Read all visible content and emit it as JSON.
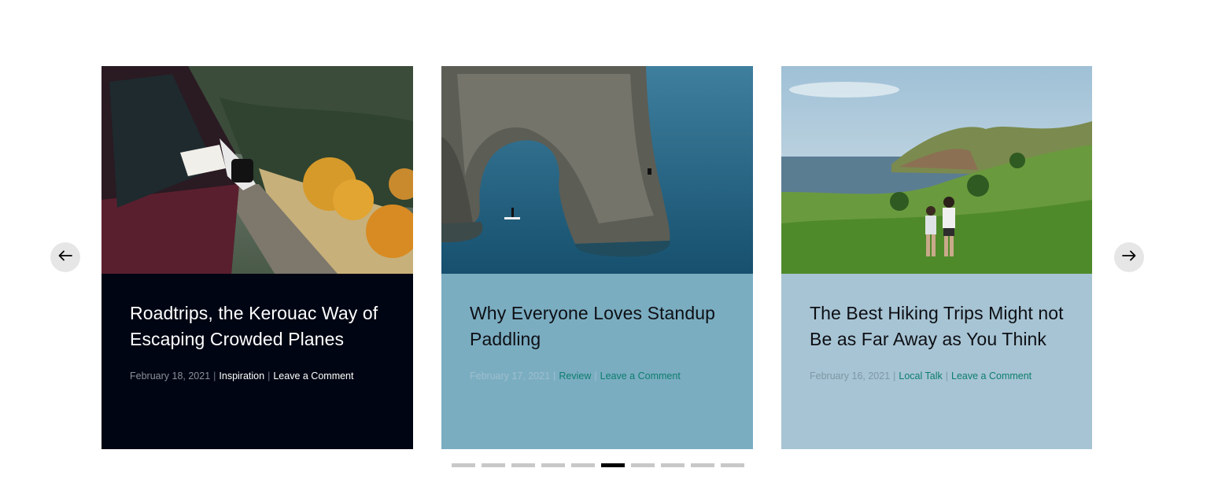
{
  "carousel": {
    "posts": [
      {
        "title": "Roadtrips, the Kerouac Way of Escaping Crowded Planes",
        "date": "February 18, 2021",
        "category": "Inspiration",
        "comment_label": "Leave a Comment",
        "separator": "|",
        "image": "car-window-feet-mountain-road",
        "colors": {
          "body": "#000513",
          "title": "#ffffff",
          "link": "#ffffff"
        }
      },
      {
        "title": "Why Everyone Loves Standup Paddling",
        "date": "February 17, 2021",
        "category": "Review",
        "comment_label": "Leave a Comment",
        "separator": "|",
        "image": "sea-rock-arch-paddleboarders",
        "colors": {
          "body": "#7badc1",
          "title": "#0d0f14",
          "link": "#0c7d6e"
        }
      },
      {
        "title": "The Best Hiking Trips Might not Be as Far Away as You Think",
        "date": "February 16, 2021",
        "category": "Local Talk",
        "comment_label": "Leave a Comment",
        "separator": "|",
        "image": "hikers-green-hills-bay",
        "colors": {
          "body": "#a7c4d4",
          "title": "#0d0f14",
          "link": "#0c7d6e"
        }
      }
    ],
    "prev_icon": "arrow-left-icon",
    "next_icon": "arrow-right-icon",
    "pagination": {
      "total": 10,
      "active_index": 5
    }
  }
}
